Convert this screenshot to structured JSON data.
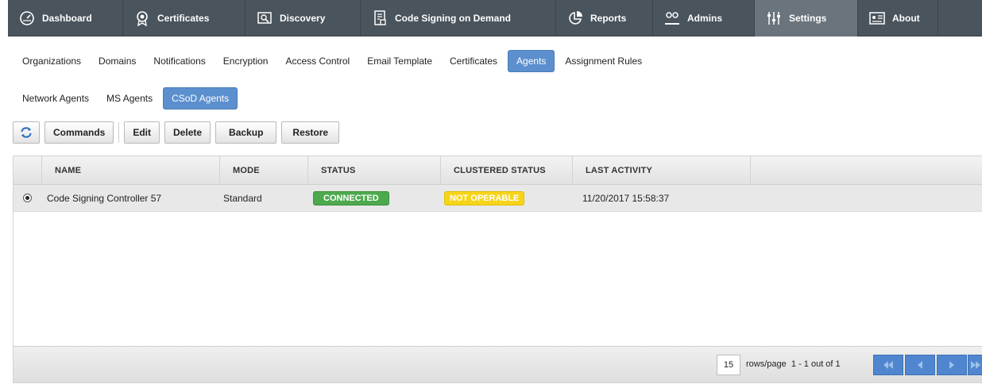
{
  "nav": {
    "items": [
      {
        "label": "Dashboard",
        "icon": "dashboard-icon"
      },
      {
        "label": "Certificates",
        "icon": "certificate-icon"
      },
      {
        "label": "Discovery",
        "icon": "discovery-icon"
      },
      {
        "label": "Code Signing on Demand",
        "icon": "code-signing-icon"
      },
      {
        "label": "Reports",
        "icon": "reports-icon"
      },
      {
        "label": "Admins",
        "icon": "admins-icon"
      },
      {
        "label": "Settings",
        "icon": "settings-icon"
      },
      {
        "label": "About",
        "icon": "about-icon"
      }
    ],
    "active": "Settings"
  },
  "subtabs": {
    "items": [
      "Organizations",
      "Domains",
      "Notifications",
      "Encryption",
      "Access Control",
      "Email Template",
      "Certificates",
      "Agents",
      "Assignment Rules"
    ],
    "active": "Agents"
  },
  "agent_tabs": {
    "items": [
      "Network Agents",
      "MS Agents",
      "CSoD Agents"
    ],
    "active": "CSoD Agents"
  },
  "toolbar": {
    "commands": "Commands",
    "edit": "Edit",
    "delete": "Delete",
    "backup": "Backup",
    "restore": "Restore"
  },
  "table": {
    "columns": [
      "NAME",
      "MODE",
      "STATUS",
      "CLUSTERED STATUS",
      "LAST ACTIVITY"
    ],
    "rows": [
      {
        "name": "Code Signing Controller 57",
        "mode": "Standard",
        "status": "CONNECTED",
        "clustered_status": "NOT OPERABLE",
        "last_activity": "11/20/2017 15:58:37",
        "selected": true
      }
    ]
  },
  "pagination": {
    "rows_per_page": "15",
    "rows_label": "rows/page",
    "range": "1 - 1 out of 1"
  },
  "colors": {
    "nav_bg": "#4a545c",
    "accent": "#5b8fce",
    "connected": "#4caa4d",
    "not_operable": "#f7d417"
  }
}
